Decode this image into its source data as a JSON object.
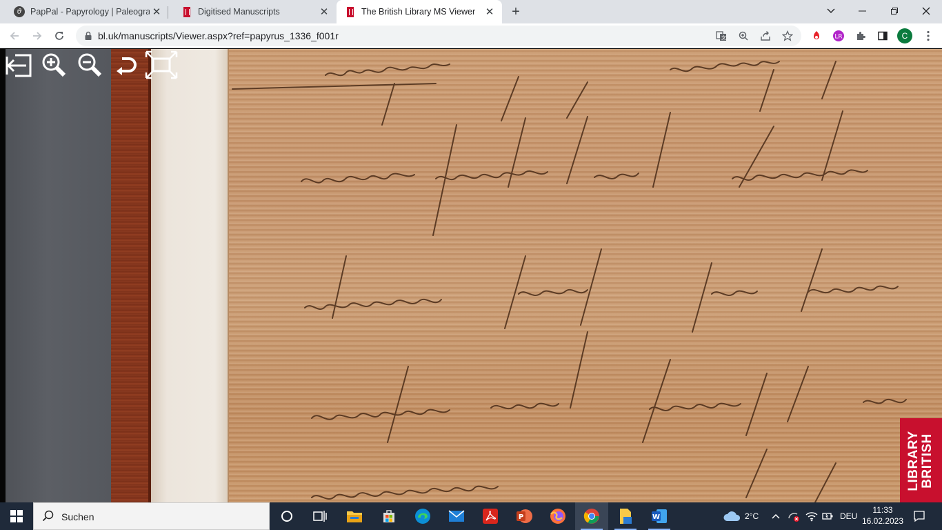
{
  "browser": {
    "tabs": [
      {
        "title": "PapPal - Papyrology | Paleograph",
        "favicon": "pappal-icon",
        "active": false
      },
      {
        "title": "Digitised Manuscripts",
        "favicon": "british-library-icon",
        "active": false
      },
      {
        "title": "The British Library MS Viewer",
        "favicon": "british-library-icon",
        "active": true
      }
    ],
    "new_tab_label": "+",
    "url": "bl.uk/manuscripts/Viewer.aspx?ref=papyrus_1336_f001r",
    "profile_initial": "C"
  },
  "viewer": {
    "tools": [
      "exit-viewer-icon",
      "zoom-in-icon",
      "zoom-out-icon",
      "rotate-icon",
      "fullscreen-icon"
    ],
    "logo": {
      "line1": "BRITISH",
      "line2": "LIBRARY"
    }
  },
  "taskbar": {
    "search_placeholder": "Suchen",
    "weather": "2°C",
    "language": "DEU",
    "time": "11:33",
    "date": "16.02.2023"
  },
  "colors": {
    "bl_red": "#c8102e",
    "tab_strip": "#dee1e6",
    "taskbar": "#1f2a3a",
    "papyrus": "#c9996f"
  }
}
